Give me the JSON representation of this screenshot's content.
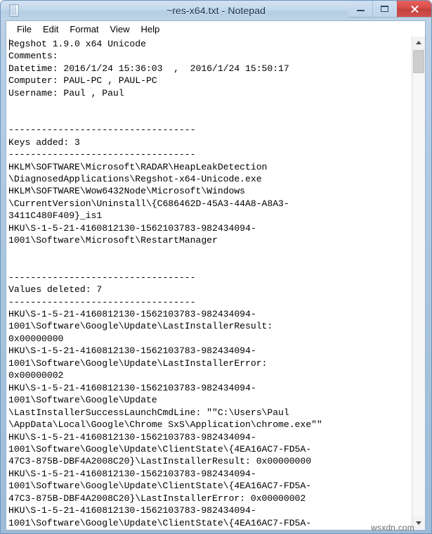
{
  "window": {
    "title": "~res-x64.txt - Notepad",
    "app_icon": "notepad-icon",
    "controls": {
      "minimize_label": "Minimize",
      "maximize_label": "Maximize",
      "close_label": "Close"
    }
  },
  "menubar": {
    "items": [
      {
        "label": "File"
      },
      {
        "label": "Edit"
      },
      {
        "label": "Format"
      },
      {
        "label": "View"
      },
      {
        "label": "Help"
      }
    ]
  },
  "document": {
    "filename": "~res-x64.txt",
    "header": {
      "program": "Regshot 1.9.0 x64 Unicode",
      "comments_label": "Comments:",
      "comments_value": "",
      "datetime_label": "Datetime:",
      "datetime_first": "2016/1/24 15:36:03",
      "datetime_second": "2016/1/24 15:50:17",
      "computer_label": "Computer:",
      "computer_first": "PAUL-PC",
      "computer_second": "PAUL-PC",
      "username_label": "Username:",
      "username_first": "Paul",
      "username_second": "Paul"
    },
    "separator": "----------------------------------",
    "sections": [
      {
        "heading": "Keys added: 3",
        "count": 3,
        "entries": [
          "HKLM\\SOFTWARE\\Microsoft\\RADAR\\HeapLeakDetection\\DiagnosedApplications\\Regshot-x64-Unicode.exe",
          "HKLM\\SOFTWARE\\Wow6432Node\\Microsoft\\Windows\\CurrentVersion\\Uninstall\\{C686462D-45A3-44A8-A8A3-3411C480F409}_is1",
          "HKU\\S-1-5-21-4160812130-1562103783-982434094-1001\\Software\\Microsoft\\RestartManager"
        ]
      },
      {
        "heading": "Values deleted: 7",
        "count": 7,
        "entries": [
          "HKU\\S-1-5-21-4160812130-1562103783-982434094-1001\\Software\\Google\\Update\\LastInstallerResult: 0x00000000",
          "HKU\\S-1-5-21-4160812130-1562103783-982434094-1001\\Software\\Google\\Update\\LastInstallerError: 0x00000002",
          "HKU\\S-1-5-21-4160812130-1562103783-982434094-1001\\Software\\Google\\Update\\LastInstallerSuccessLaunchCmdLine: \"\"C:\\Users\\Paul\\AppData\\Local\\Google\\Chrome SxS\\Application\\chrome.exe\"\"",
          "HKU\\S-1-5-21-4160812130-1562103783-982434094-1001\\Software\\Google\\Update\\ClientState\\{4EA16AC7-FD5A-47C3-875B-DBF4A2008C20}\\LastInstallerResult: 0x00000000",
          "HKU\\S-1-5-21-4160812130-1562103783-982434094-1001\\Software\\Google\\Update\\ClientState\\{4EA16AC7-FD5A-47C3-875B-DBF4A2008C20}\\LastInstallerError: 0x00000002",
          "HKU\\S-1-5-21-4160812130-1562103783-982434094-1001\\Software\\Google\\Update\\ClientState\\{4EA16AC7-FD5A-"
        ]
      }
    ],
    "visible_text": "Regshot 1.9.0 x64 Unicode\nComments:\nDatetime: 2016/1/24 15:36:03  ,  2016/1/24 15:50:17\nComputer: PAUL-PC , PAUL-PC\nUsername: Paul , Paul\n\n\n----------------------------------\nKeys added: 3\n----------------------------------\nHKLM\\SOFTWARE\\Microsoft\\RADAR\\HeapLeakDetection\n\\DiagnosedApplications\\Regshot-x64-Unicode.exe\nHKLM\\SOFTWARE\\Wow6432Node\\Microsoft\\Windows\n\\CurrentVersion\\Uninstall\\{C686462D-45A3-44A8-A8A3-\n3411C480F409}_is1\nHKU\\S-1-5-21-4160812130-1562103783-982434094-\n1001\\Software\\Microsoft\\RestartManager\n\n\n----------------------------------\nValues deleted: 7\n----------------------------------\nHKU\\S-1-5-21-4160812130-1562103783-982434094-\n1001\\Software\\Google\\Update\\LastInstallerResult:\n0x00000000\nHKU\\S-1-5-21-4160812130-1562103783-982434094-\n1001\\Software\\Google\\Update\\LastInstallerError:\n0x00000002\nHKU\\S-1-5-21-4160812130-1562103783-982434094-\n1001\\Software\\Google\\Update\n\\LastInstallerSuccessLaunchCmdLine: \"\"C:\\Users\\Paul\n\\AppData\\Local\\Google\\Chrome SxS\\Application\\chrome.exe\"\"\nHKU\\S-1-5-21-4160812130-1562103783-982434094-\n1001\\Software\\Google\\Update\\ClientState\\{4EA16AC7-FD5A-\n47C3-875B-DBF4A2008C20}\\LastInstallerResult: 0x00000000\nHKU\\S-1-5-21-4160812130-1562103783-982434094-\n1001\\Software\\Google\\Update\\ClientState\\{4EA16AC7-FD5A-\n47C3-875B-DBF4A2008C20}\\LastInstallerError: 0x00000002\nHKU\\S-1-5-21-4160812130-1562103783-982434094-\n1001\\Software\\Google\\Update\\ClientState\\{4EA16AC7-FD5A-"
  },
  "scrollbar": {
    "up_icon": "chevron-up-icon",
    "down_icon": "chevron-down-icon",
    "thumb_label": "scroll-thumb"
  },
  "watermark": {
    "text": "wsxdn.com"
  }
}
